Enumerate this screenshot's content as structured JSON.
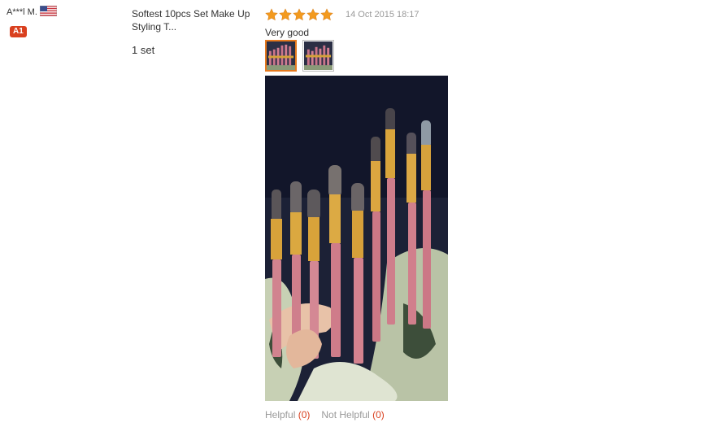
{
  "buyer": {
    "name": "A***l M.",
    "country_flag_icon": "us-flag-icon",
    "level_badge": "A1"
  },
  "order": {
    "product_title": "Softest 10pcs Set Make Up Styling T...",
    "quantity": "1 set"
  },
  "review": {
    "rating": 5,
    "rating_max": 5,
    "date": "14 Oct 2015 18:17",
    "text": "Very good",
    "thumbnails": [
      {
        "name": "review-photo-thumb-1",
        "selected": true
      },
      {
        "name": "review-photo-thumb-2",
        "selected": false
      }
    ],
    "photo_description_icon": "makeup-brushes-photo"
  },
  "feedback": {
    "helpful_label": "Helpful",
    "helpful_count": "(0)",
    "not_helpful_label": "Not Helpful",
    "not_helpful_count": "(0)"
  },
  "colors": {
    "star": "#f39a1e",
    "badge": "#d9401f",
    "thumb_active_border": "#e5791e",
    "muted_text": "#999999"
  }
}
